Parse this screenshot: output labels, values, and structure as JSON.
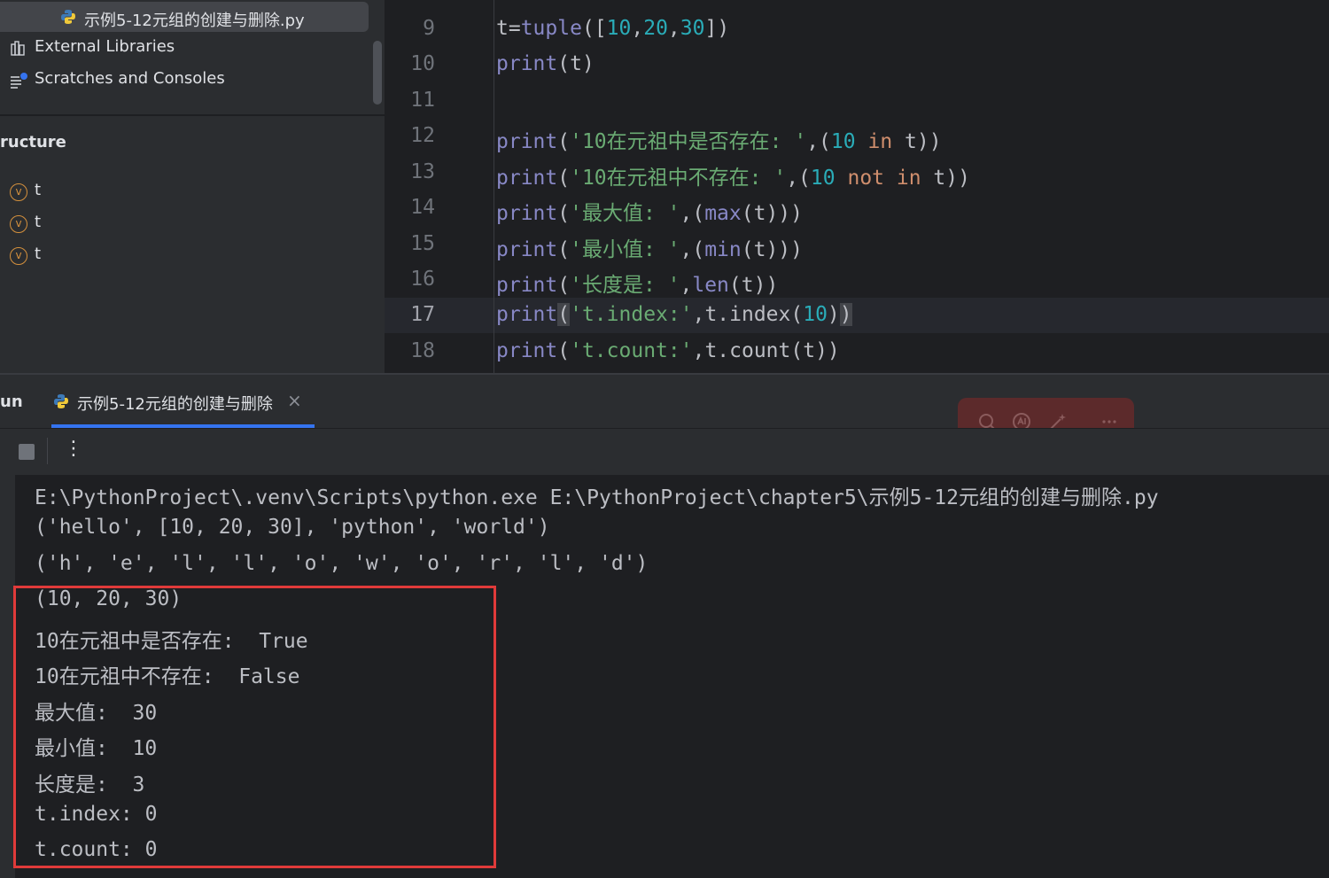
{
  "project": {
    "file_name": "示例5-12元组的创建与删除.py",
    "tree": [
      {
        "label": "External Libraries",
        "icon": "library-icon"
      },
      {
        "label": "Scratches and Consoles",
        "icon": "scratches-icon"
      }
    ]
  },
  "structure": {
    "title": "ructure",
    "items": [
      {
        "icon_text": "v",
        "label": "t"
      },
      {
        "icon_text": "v",
        "label": "t"
      },
      {
        "icon_text": "v",
        "label": "t"
      }
    ]
  },
  "editor": {
    "current_line": 17,
    "lines": [
      {
        "n": "9",
        "code": "t=tuple([10,20,30])"
      },
      {
        "n": "10",
        "code": "print(t)"
      },
      {
        "n": "11",
        "code": ""
      },
      {
        "n": "12",
        "code": "print('10在元祖中是否存在: ',(10 in t))"
      },
      {
        "n": "13",
        "code": "print('10在元祖中不存在: ',(10 not in t))"
      },
      {
        "n": "14",
        "code": "print('最大值: ',(max(t)))"
      },
      {
        "n": "15",
        "code": "print('最小值: ',(min(t)))"
      },
      {
        "n": "16",
        "code": "print('长度是: ',len(t))"
      },
      {
        "n": "17",
        "code": "print('t.index:',t.index(10))"
      },
      {
        "n": "18",
        "code": "print('t.count:',t.count(t))"
      }
    ]
  },
  "run": {
    "title": "un",
    "tab_label": "示例5-12元组的创建与删除",
    "close_glyph": "×",
    "more_glyph": "⋮",
    "output": [
      "E:\\PythonProject\\.venv\\Scripts\\python.exe E:\\PythonProject\\chapter5\\示例5-12元组的创建与删除.py",
      "('hello', [10, 20, 30], 'python', 'world')",
      "('h', 'e', 'l', 'l', 'o', 'w', 'o', 'r', 'l', 'd')",
      "(10, 20, 30)",
      "10在元祖中是否存在:  True",
      "10在元祖中不存在:  False",
      "最大值:  30",
      "最小值:  10",
      "长度是:  3",
      "t.index: 0",
      "t.count: 0"
    ]
  },
  "colors": {
    "highlight_box": "#e03a3a",
    "accent": "#3574f0",
    "number": "#2aacb8",
    "string": "#6aab73",
    "keyword": "#cf8e6d",
    "builtin": "#8888c6"
  },
  "floating_toolbar": {
    "icons": [
      "search-icon",
      "ai-assistant-icon",
      "magic-wand-icon",
      "more-icon"
    ]
  }
}
